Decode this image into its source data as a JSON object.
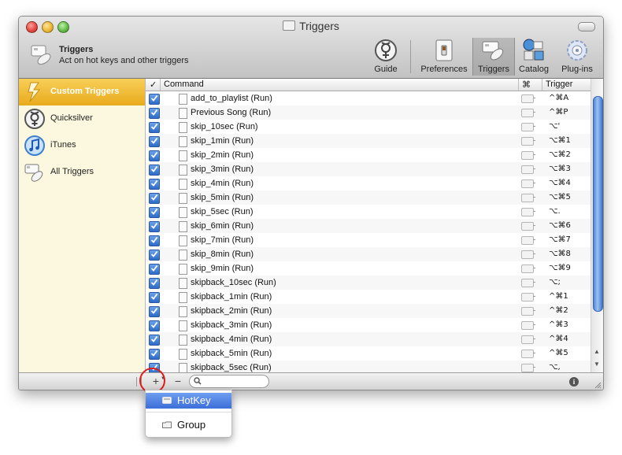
{
  "window": {
    "title": "Triggers"
  },
  "header": {
    "title": "Triggers",
    "subtitle": "Act on hot keys and other triggers"
  },
  "toolbar": {
    "items": [
      {
        "label": "Guide",
        "icon": "quicksilver-icon"
      },
      {
        "label": "Preferences",
        "icon": "light-switch-icon"
      },
      {
        "label": "Triggers",
        "icon": "remote-icon",
        "selected": true
      },
      {
        "label": "Catalog",
        "icon": "catalog-icon"
      },
      {
        "label": "Plug-ins",
        "icon": "gear-icon"
      }
    ]
  },
  "sidebar": {
    "items": [
      {
        "label": "Custom Triggers",
        "icon": "lightning-icon",
        "selected": true
      },
      {
        "label": "Quicksilver",
        "icon": "quicksilver-icon"
      },
      {
        "label": "iTunes",
        "icon": "itunes-icon"
      },
      {
        "label": "All Triggers",
        "icon": "remote-icon"
      }
    ]
  },
  "table": {
    "columns": {
      "check": "✓",
      "command": "Command",
      "cmd": "⌘",
      "trigger": "Trigger"
    },
    "rows": [
      {
        "command": "add_to_playlist (Run)",
        "trigger": "^⌘A",
        "checked": true
      },
      {
        "command": "Previous Song (Run)",
        "trigger": "^⌘P",
        "checked": true
      },
      {
        "command": "skip_10sec (Run)",
        "trigger": "⌥'",
        "checked": true
      },
      {
        "command": "skip_1min (Run)",
        "trigger": "⌥⌘1",
        "checked": true
      },
      {
        "command": "skip_2min (Run)",
        "trigger": "⌥⌘2",
        "checked": true
      },
      {
        "command": "skip_3min (Run)",
        "trigger": "⌥⌘3",
        "checked": true
      },
      {
        "command": "skip_4min (Run)",
        "trigger": "⌥⌘4",
        "checked": true
      },
      {
        "command": "skip_5min (Run)",
        "trigger": "⌥⌘5",
        "checked": true
      },
      {
        "command": "skip_5sec (Run)",
        "trigger": "⌥.",
        "checked": true
      },
      {
        "command": "skip_6min (Run)",
        "trigger": "⌥⌘6",
        "checked": true
      },
      {
        "command": "skip_7min (Run)",
        "trigger": "⌥⌘7",
        "checked": true
      },
      {
        "command": "skip_8min (Run)",
        "trigger": "⌥⌘8",
        "checked": true
      },
      {
        "command": "skip_9min (Run)",
        "trigger": "⌥⌘9",
        "checked": true
      },
      {
        "command": "skipback_10sec (Run)",
        "trigger": "⌥;",
        "checked": true
      },
      {
        "command": "skipback_1min (Run)",
        "trigger": "^⌘1",
        "checked": true
      },
      {
        "command": "skipback_2min (Run)",
        "trigger": "^⌘2",
        "checked": true
      },
      {
        "command": "skipback_3min (Run)",
        "trigger": "^⌘3",
        "checked": true
      },
      {
        "command": "skipback_4min (Run)",
        "trigger": "^⌘4",
        "checked": true
      },
      {
        "command": "skipback_5min (Run)",
        "trigger": "^⌘5",
        "checked": true
      },
      {
        "command": "skipback_5sec (Run)",
        "trigger": "⌥,",
        "checked": true
      }
    ]
  },
  "bottombar": {
    "add": "+",
    "remove": "−",
    "info": "i",
    "search_placeholder": ""
  },
  "add_menu": {
    "items": [
      {
        "label": "HotKey",
        "highlighted": true
      },
      {
        "label": "Group"
      }
    ]
  },
  "colors": {
    "accent": "#3b6ed9",
    "sidebar_bg": "#fcf8df",
    "sidebar_selected": "#f0bb30",
    "highlight_ring": "#e01b1b"
  }
}
